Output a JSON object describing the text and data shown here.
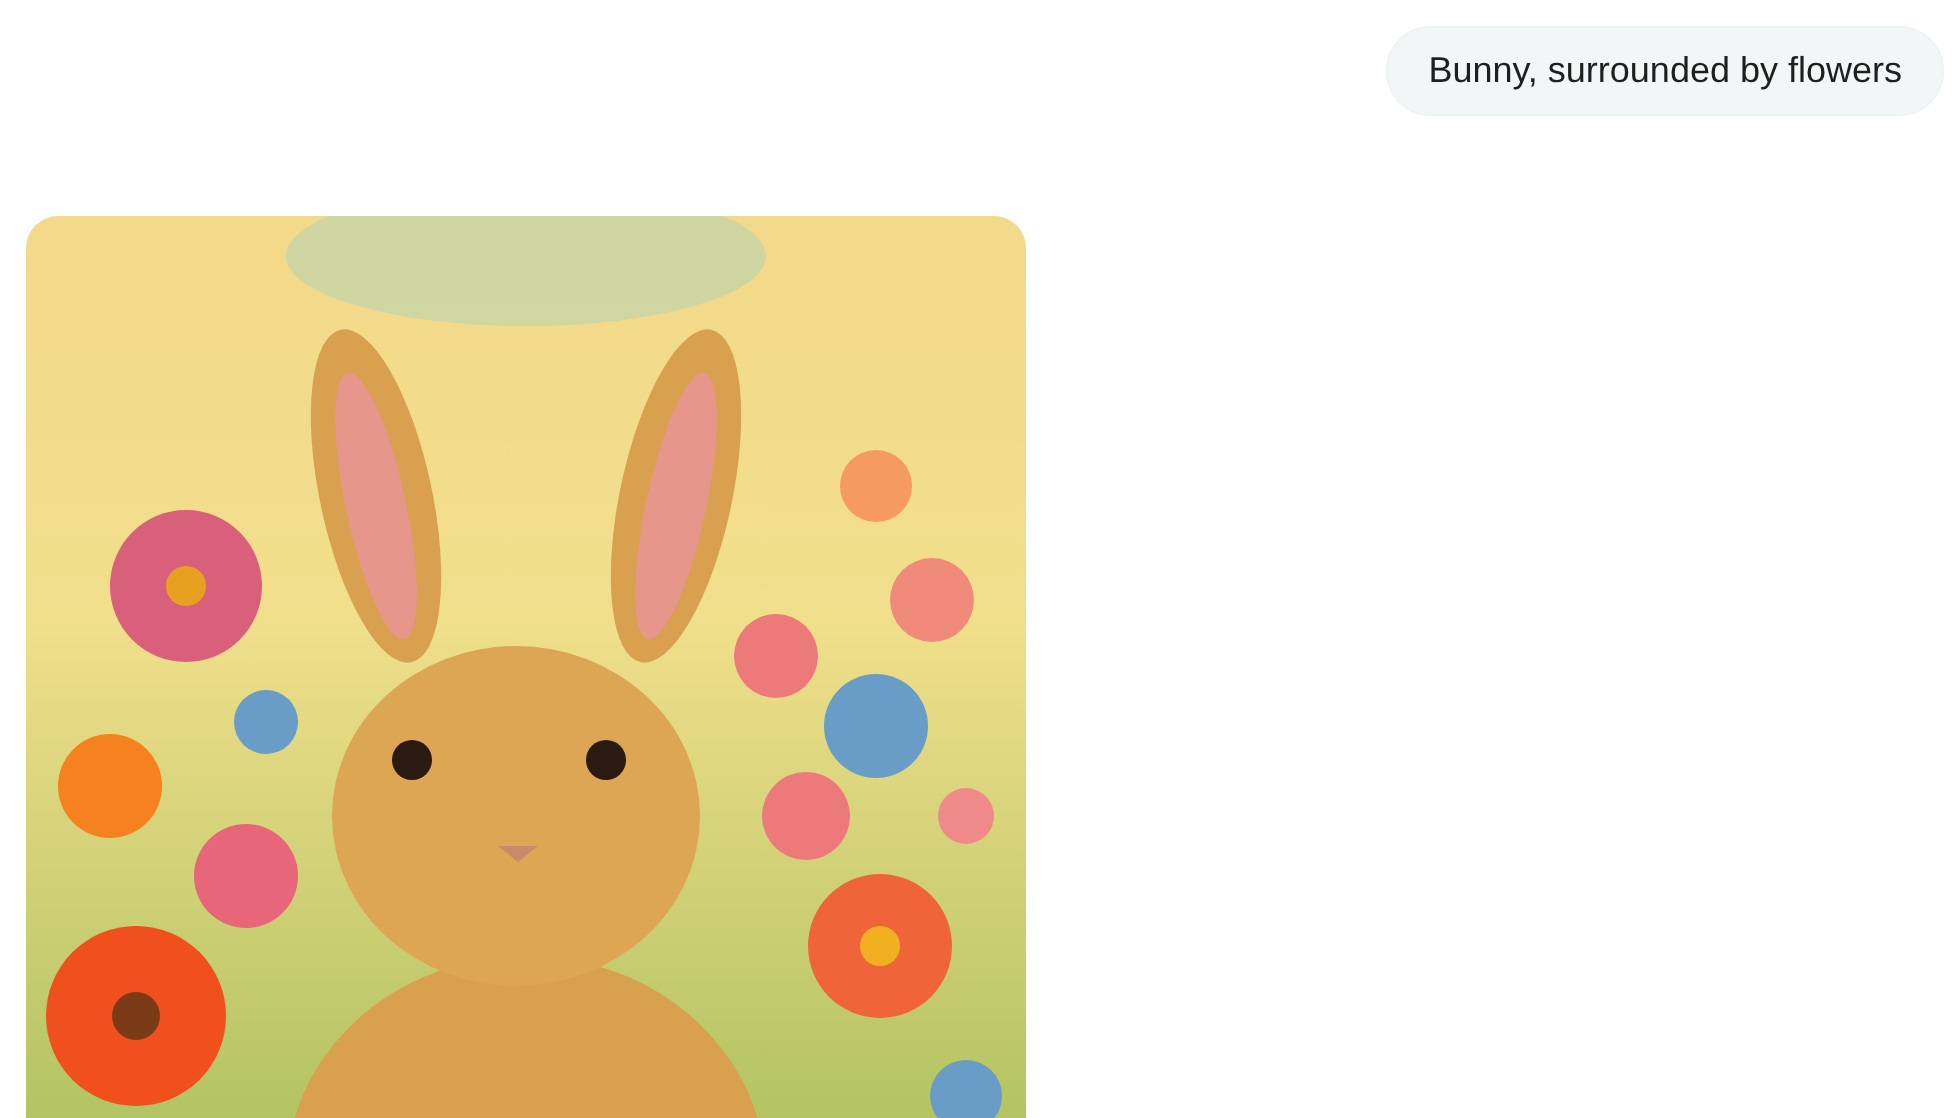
{
  "messages": [
    {
      "kind": "user",
      "text": "Bunny, surrounded by flowers"
    },
    {
      "kind": "image"
    }
  ]
}
